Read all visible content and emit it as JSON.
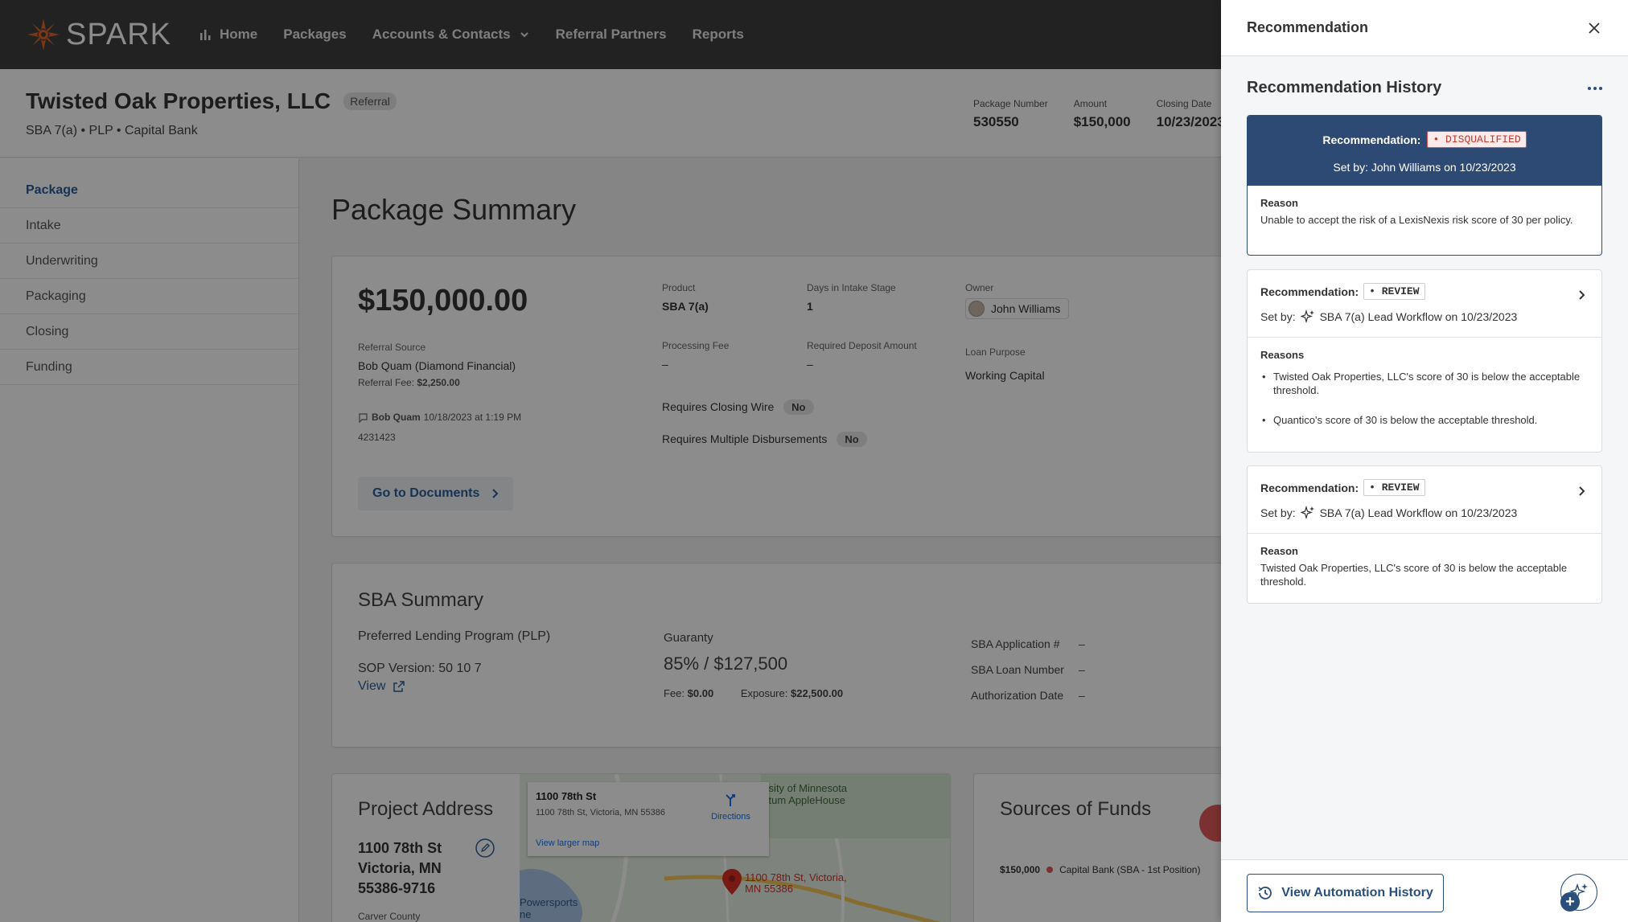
{
  "app": {
    "logo_text": "SPARK"
  },
  "nav": {
    "items": [
      {
        "label": "Home"
      },
      {
        "label": "Packages"
      },
      {
        "label": "Accounts & Contacts"
      },
      {
        "label": "Referral Partners"
      },
      {
        "label": "Reports"
      }
    ]
  },
  "header": {
    "company_name": "Twisted Oak Properties, LLC",
    "badge": "Referral",
    "subtitle": "SBA 7(a) • PLP • Capital Bank",
    "stats": [
      {
        "label": "Package Number",
        "value": "530550"
      },
      {
        "label": "Amount",
        "value": "$150,000"
      },
      {
        "label": "Closing Date",
        "value": "10/23/2023"
      }
    ]
  },
  "sidebar": {
    "items": [
      {
        "label": "Package"
      },
      {
        "label": "Intake"
      },
      {
        "label": "Underwriting"
      },
      {
        "label": "Packaging"
      },
      {
        "label": "Closing"
      },
      {
        "label": "Funding"
      }
    ]
  },
  "main": {
    "page_title": "Package Summary",
    "summary": {
      "amount": "$150,000.00",
      "referral_source_label": "Referral Source",
      "referral_source": "Bob Quam (Diamond Financial)",
      "referral_fee_label": "Referral Fee:",
      "referral_fee": "$2,250.00",
      "note_author": "Bob Quam",
      "note_time": "10/18/2023 at 1:19 PM",
      "note_text": "4231423",
      "product_label": "Product",
      "product": "SBA 7(a)",
      "days_label": "Days in Intake Stage",
      "days": "1",
      "owner_label": "Owner",
      "owner": "John Williams",
      "processing_fee_label": "Processing Fee",
      "processing_fee": "–",
      "deposit_label": "Required Deposit Amount",
      "deposit": "–",
      "loan_purpose_label": "Loan Purpose",
      "loan_purpose": "Working Capital",
      "closing_wire_label": "Requires Closing Wire",
      "closing_wire": "No",
      "multi_disb_label": "Requires Multiple Disbursements",
      "multi_disb": "No",
      "go_docs": "Go to Documents"
    },
    "sba": {
      "title": "SBA Summary",
      "program": "Preferred Lending Program (PLP)",
      "sop": "SOP Version: 50 10 7",
      "view": "View",
      "guaranty_label": "Guaranty",
      "guaranty": "85% / $127,500",
      "fee_label": "Fee:",
      "fee": "$0.00",
      "exposure_label": "Exposure:",
      "exposure": "$22,500.00",
      "app_no_label": "SBA Application #",
      "app_no": "–",
      "loan_no_label": "SBA Loan Number",
      "loan_no": "–",
      "auth_label": "Authorization Date",
      "auth": "–"
    },
    "project": {
      "title": "Project Address",
      "line1": "1100 78th St",
      "line2": "Victoria, MN",
      "line3": "55386-9716",
      "county": "Carver County",
      "map_title": "1100 78th St",
      "map_addr": "1100 78th St, Victoria, MN 55386",
      "map_directions": "Directions",
      "map_larger": "View larger map",
      "map_pin": "1100 78th St, Victoria, MN 55386",
      "map_poi1": "ersity of Minnesota",
      "map_poi2": "retum AppleHouse",
      "map_poi3": "Powersports",
      "map_poi4": "ne"
    },
    "funds": {
      "title": "Sources of Funds",
      "amount": "$150,000",
      "source": "Capital Bank (SBA - 1st Position)"
    }
  },
  "panel": {
    "title": "Recommendation",
    "history_title": "Recommendation History",
    "cards": [
      {
        "rec_label": "Recommendation:",
        "status": "• DISQUALIFIED",
        "set_by": "Set by: John Williams on 10/23/2023",
        "reason_label": "Reason",
        "reason": "Unable to accept the risk of a LexisNexis risk score of 30 per policy."
      },
      {
        "rec_label": "Recommendation:",
        "status": "• REVIEW",
        "set_by_label": "Set by:",
        "set_by": "SBA 7(a) Lead Workflow on 10/23/2023",
        "reason_label": "Reasons",
        "reasons": [
          "Twisted Oak Properties, LLC's score of 30 is below the acceptable threshold.",
          "Quantico's score of 30 is below the acceptable threshold."
        ]
      },
      {
        "rec_label": "Recommendation:",
        "status": "• REVIEW",
        "set_by_label": "Set by:",
        "set_by": "SBA 7(a) Lead Workflow on 10/23/2023",
        "reason_label": "Reason",
        "reason": "Twisted Oak Properties, LLC's score of 30 is below the acceptable threshold."
      }
    ],
    "view_automation": "View Automation History"
  },
  "colors": {
    "nav_bg": "#3f3f3f",
    "brand_orange": "#e0662a",
    "accent_blue": "#2a4f7a",
    "link_blue": "#2a5e99",
    "disqualified_red": "#c0392b",
    "map_pin_red": "#d93025"
  }
}
